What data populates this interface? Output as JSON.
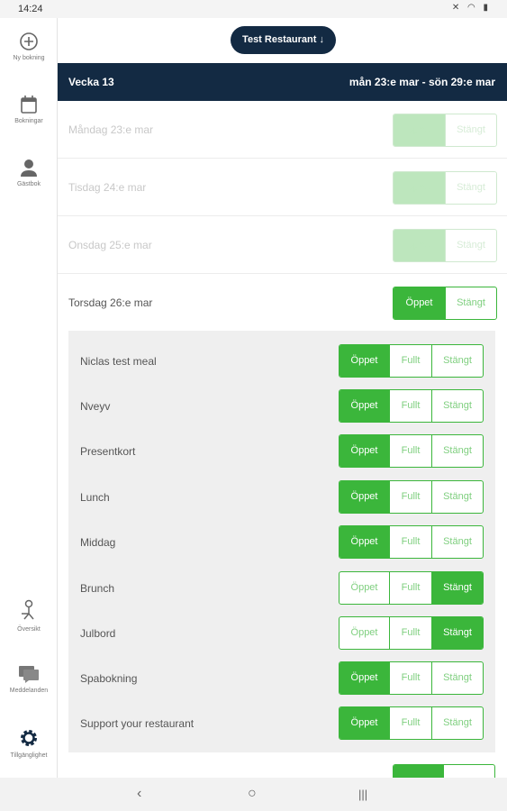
{
  "status_bar": {
    "time": "14:24",
    "icons": "✕ ◠ ▮"
  },
  "sidebar": {
    "items": [
      {
        "label": "Ny bokning",
        "icon": "add-circle-icon"
      },
      {
        "label": "Bokningar",
        "icon": "calendar-icon"
      },
      {
        "label": "Gästbok",
        "icon": "person-icon"
      },
      {
        "label": "Översikt",
        "icon": "waiter-icon"
      },
      {
        "label": "Meddelanden",
        "icon": "chat-icon"
      },
      {
        "label": "Tillgänglighet",
        "icon": "gear-icon"
      }
    ]
  },
  "header": {
    "restaurant": "Test Restaurant",
    "arrow": "↓"
  },
  "week": {
    "label": "Vecka 13",
    "range": "mån 23:e mar - sön 29:e mar"
  },
  "days": [
    {
      "label": "Måndag 23:e mar",
      "state": "open",
      "open": "Öppet",
      "closed": "Stängt",
      "dim": true
    },
    {
      "label": "Tisdag 24:e mar",
      "state": "open",
      "open": "Öppet",
      "closed": "Stängt",
      "dim": true
    },
    {
      "label": "Onsdag 25:e mar",
      "state": "open",
      "open": "Öppet",
      "closed": "Stängt",
      "dim": true
    },
    {
      "label": "Torsdag 26:e mar",
      "state": "open",
      "open": "Öppet",
      "closed": "Stängt",
      "dim": false
    }
  ],
  "seg_labels": {
    "open": "Öppet",
    "full": "Fullt",
    "closed": "Stängt"
  },
  "meals": [
    {
      "label": "Niclas test meal",
      "state": "open"
    },
    {
      "label": "Nveyv",
      "state": "open"
    },
    {
      "label": "Presentkort",
      "state": "open"
    },
    {
      "label": "Lunch",
      "state": "open"
    },
    {
      "label": "Middag",
      "state": "open"
    },
    {
      "label": "Brunch",
      "state": "closed"
    },
    {
      "label": "Julbord",
      "state": "closed"
    },
    {
      "label": "Spabokning",
      "state": "open"
    },
    {
      "label": "Support your restaurant",
      "state": "open"
    }
  ],
  "colors": {
    "accent": "#3bb63b",
    "navy": "#132a43"
  },
  "nav_bar": {
    "back": "‹",
    "home": "○",
    "recents": "|||"
  }
}
